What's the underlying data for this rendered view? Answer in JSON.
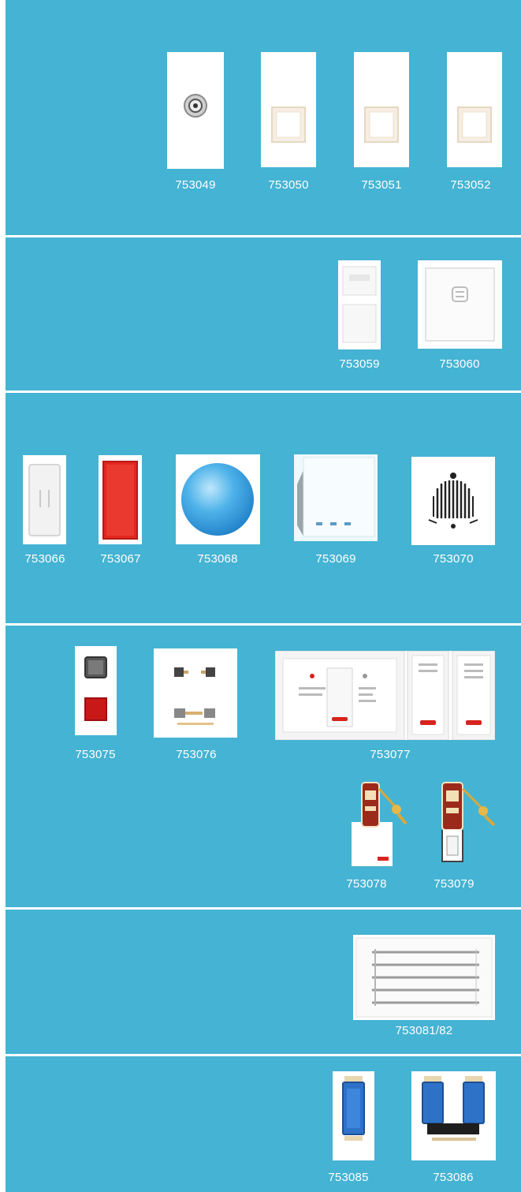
{
  "catalog": {
    "sections": [
      {
        "id": "row1",
        "products": [
          {
            "code": "753049",
            "icon": "tv-coax-socket-icon"
          },
          {
            "code": "753050",
            "icon": "blank-module-icon"
          },
          {
            "code": "753051",
            "icon": "blank-module-icon"
          },
          {
            "code": "753052",
            "icon": "blank-module-icon"
          }
        ]
      },
      {
        "id": "row2",
        "products": [
          {
            "code": "753059",
            "icon": "data-socket-module-icon"
          },
          {
            "code": "753060",
            "icon": "shaver-socket-plate-icon"
          }
        ]
      },
      {
        "id": "row3",
        "products": [
          {
            "code": "753066",
            "icon": "white-lens-module-icon"
          },
          {
            "code": "753067",
            "icon": "red-lens-module-icon"
          },
          {
            "code": "753068",
            "icon": "blue-sphere-indicator-icon"
          },
          {
            "code": "753069",
            "icon": "angled-plate-icon"
          },
          {
            "code": "753070",
            "icon": "bell-icon"
          }
        ]
      },
      {
        "id": "row4",
        "products": [
          {
            "code": "753075",
            "icon": "indicator-module-icon"
          },
          {
            "code": "753076",
            "icon": "terminal-plate-icon"
          },
          {
            "code": "753077",
            "icon": "do-not-disturb-switch-icon"
          },
          {
            "code": "753078",
            "icon": "key-tag-holder-icon"
          },
          {
            "code": "753079",
            "icon": "key-tag-icon"
          }
        ]
      },
      {
        "id": "row5",
        "products": [
          {
            "code": "753081/82",
            "icon": "grille-plate-icon"
          }
        ]
      },
      {
        "id": "row6",
        "products": [
          {
            "code": "753085",
            "icon": "blue-connector-module-icon"
          },
          {
            "code": "753086",
            "icon": "double-blue-connector-icon"
          }
        ]
      }
    ]
  },
  "colors": {
    "band": "#45b3d3",
    "red_accent": "#d8231e",
    "blue_accent": "#2e72c8"
  }
}
